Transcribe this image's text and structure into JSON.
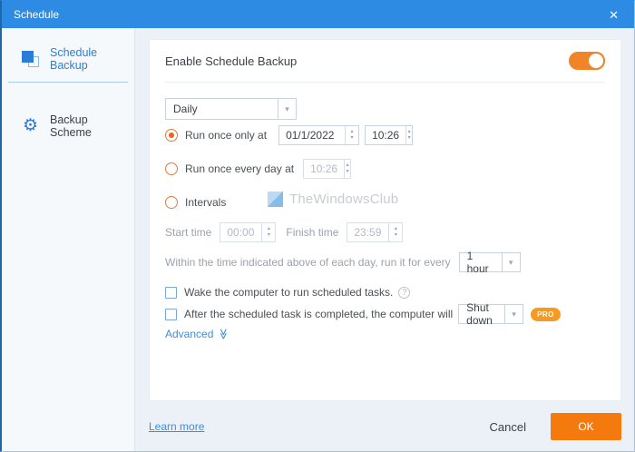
{
  "window": {
    "title": "Schedule"
  },
  "icons": {
    "close": "✕",
    "gear": "⚙",
    "chevron_down": "▾",
    "spin_up": "▴",
    "spin_down": "▾",
    "help": "?",
    "advanced_chevrons": "≫"
  },
  "sidebar": {
    "items": [
      {
        "label": "Schedule Backup"
      },
      {
        "label": "Backup Scheme"
      }
    ]
  },
  "panel": {
    "enable_label": "Enable Schedule Backup",
    "frequency": {
      "value": "Daily"
    },
    "run_once": {
      "label": "Run once only at",
      "date": "01/1/2022",
      "time": "10:26"
    },
    "run_every_day": {
      "label": "Run once every day at",
      "time": "10:26"
    },
    "intervals": {
      "label": "Intervals",
      "start_label": "Start time",
      "start_value": "00:00",
      "finish_label": "Finish time",
      "finish_value": "23:59",
      "every_text": "Within the time indicated above of each day, run it for every",
      "every_value": "1 hour"
    },
    "wake": {
      "label": "Wake the computer to run scheduled tasks."
    },
    "after": {
      "label": "After the scheduled task is completed, the computer will",
      "value": "Shut down",
      "badge": "PRO"
    },
    "advanced_label": "Advanced"
  },
  "watermark": {
    "text": "TheWindowsClub"
  },
  "footer": {
    "learn_more": "Learn more",
    "cancel": "Cancel",
    "ok": "OK"
  },
  "colors": {
    "titlebar_blue": "#2e8be4",
    "accent_blue": "#2b7fd9",
    "accent_orange": "#f08428",
    "ok_orange": "#f57a0d",
    "pro_badge": "#f59b24",
    "link_blue": "#3e8ddb"
  }
}
